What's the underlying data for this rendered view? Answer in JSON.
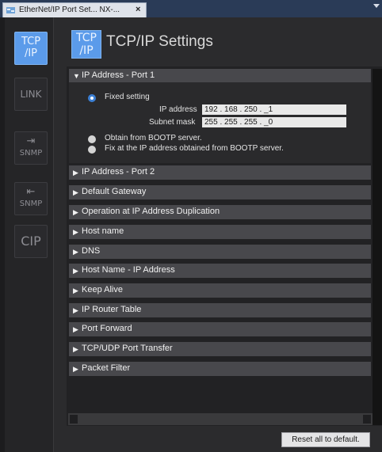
{
  "window": {
    "tab_title": "EtherNet/IP Port Set... NX-...",
    "close_glyph": "×"
  },
  "sidebar": {
    "items": [
      {
        "icon": "tcp-ip-icon",
        "lines": [
          "TCP",
          "/IP"
        ],
        "active": true
      },
      {
        "icon": "link-icon",
        "lines": [
          "LINK"
        ],
        "active": false
      },
      {
        "icon": "snmp-send-icon",
        "lines": [
          "⇥",
          "SNMP"
        ],
        "active": false
      },
      {
        "icon": "snmp-receive-icon",
        "lines": [
          "⇤",
          "SNMP"
        ],
        "active": false
      },
      {
        "icon": "cip-icon",
        "lines": [
          "CIP"
        ],
        "active": false
      }
    ]
  },
  "header": {
    "icon_lines": [
      "TCP",
      "/IP"
    ],
    "title": "TCP/IP Settings"
  },
  "ip_port1": {
    "label": "IP Address - Port 1",
    "fixed_setting": "Fixed setting",
    "ip_label": "IP address",
    "ip_value": "192 . 168 . 250 . _1",
    "mask_label": "Subnet mask",
    "mask_value": "255 . 255 . 255 . _0",
    "bootp": "Obtain from BOOTP server.",
    "bootp_fix": "Fix at the IP address obtained from BOOTP server."
  },
  "sections": [
    "IP Address - Port 2",
    "Default Gateway",
    "Operation at IP Address Duplication",
    "Host name",
    "DNS",
    "Host Name - IP Address",
    "Keep Alive",
    "IP Router Table",
    "Port Forward",
    "TCP/UDP Port Transfer",
    "Packet Filter"
  ],
  "reset_label": "Reset all to default.",
  "colors": {
    "accent": "#5b9bea",
    "section": "#48484c",
    "background": "#2b2b2d"
  }
}
